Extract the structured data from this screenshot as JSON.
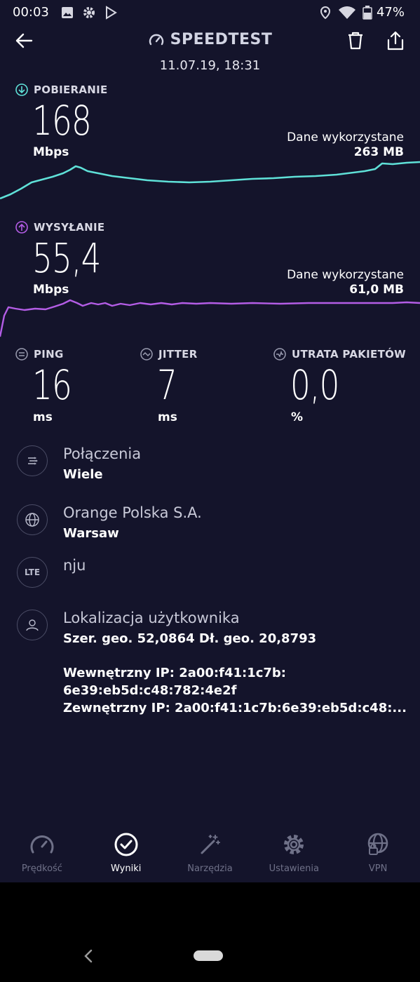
{
  "status_bar": {
    "time": "00:03",
    "battery": "47%",
    "icons": [
      "image-icon",
      "gear-icon",
      "play-store-icon",
      "location-icon",
      "wifi-icon",
      "battery-icon"
    ]
  },
  "header": {
    "title": "SPEEDTEST",
    "date": "11.07.19, 18:31",
    "icons": [
      "back-arrow-icon",
      "speedometer-icon",
      "trash-icon",
      "share-icon"
    ]
  },
  "download": {
    "label": "POBIERANIE",
    "value": "168",
    "unit": "Mbps",
    "data_used_label": "Dane wykorzystane",
    "data_used_value": "263 MB",
    "color": "#5fe1d8"
  },
  "upload": {
    "label": "WYSYŁANIE",
    "value": "55,4",
    "unit": "Mbps",
    "data_used_label": "Dane wykorzystane",
    "data_used_value": "61,0 MB",
    "color": "#b45de6"
  },
  "metrics": [
    {
      "label": "PING",
      "value": "16",
      "unit": "ms"
    },
    {
      "label": "JITTER",
      "value": "7",
      "unit": "ms"
    },
    {
      "label": "UTRATA PAKIETÓW",
      "value": "0,0",
      "unit": "%"
    }
  ],
  "info": {
    "connections": {
      "title": "Połączenia",
      "subtitle": "Wiele"
    },
    "provider": {
      "title": "Orange Polska S.A.",
      "subtitle": "Warsaw"
    },
    "network": {
      "badge": "LTE",
      "title": "nju"
    },
    "location": {
      "title": "Lokalizacja użytkownika",
      "coords": "Szer. geo. 52,0864 Dł. geo. 20,8793",
      "internal_ip_line1": "Wewnętrzny IP: 2a00:f41:1c7b:",
      "internal_ip_line2": "6e39:eb5d:c48:782:4e2f",
      "external_ip": "Zewnętrzny IP: 2a00:f41:1c7b:6e39:eb5d:c48:..."
    }
  },
  "bottom_nav": [
    {
      "label": "Prędkość",
      "icon": "speedometer-icon",
      "active": false
    },
    {
      "label": "Wyniki",
      "icon": "checkmark-circle-icon",
      "active": true
    },
    {
      "label": "Narzędzia",
      "icon": "magic-wand-icon",
      "active": false
    },
    {
      "label": "Ustawienia",
      "icon": "gear-icon",
      "active": false
    },
    {
      "label": "VPN",
      "icon": "globe-lock-icon",
      "active": false
    }
  ]
}
